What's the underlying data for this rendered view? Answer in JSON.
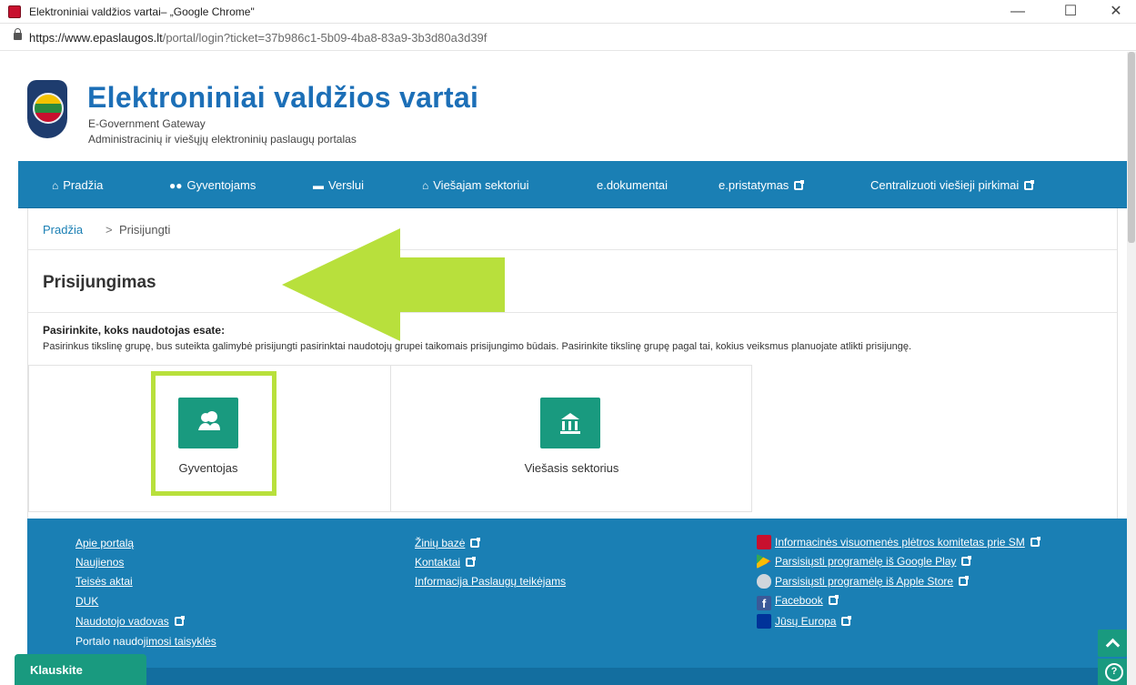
{
  "window": {
    "title": "Elektroniniai valdžios vartai– „Google Chrome\"",
    "minimize_glyph": "—",
    "maximize_glyph": "☐",
    "close_glyph": "✕"
  },
  "address": {
    "host": "https://www.epaslaugos.lt",
    "path": "/portal/login?ticket=37b986c1-5b09-4ba8-83a9-3b3d80a3d39f"
  },
  "header": {
    "title": "Elektroniniai valdžios vartai",
    "subtitle_en": "E-Government Gateway",
    "subtitle_lt": "Administracinių ir viešųjų elektroninių paslaugų portalas"
  },
  "nav": {
    "items": [
      {
        "label": "Pradžia",
        "icon": "home-icon"
      },
      {
        "label": "Gyventojams",
        "icon": "users-icon"
      },
      {
        "label": "Verslui",
        "icon": "briefcase-icon"
      },
      {
        "label": "Viešajam sektoriui",
        "icon": "institution-icon"
      },
      {
        "label": "e.dokumentai"
      },
      {
        "label": "e.pristatymas",
        "icon": "external-link-icon"
      },
      {
        "label": "Centralizuoti viešieji pirkimai",
        "icon": "external-link-icon"
      }
    ]
  },
  "breadcrumb": {
    "home": "Pradžia",
    "separator": ">",
    "current": "Prisijungti"
  },
  "page": {
    "title": "Prisijungimas",
    "choose_title": "Pasirinkite, koks naudotojas esate:",
    "choose_desc": "Pasirinkus tikslinę grupę, bus suteikta galimybė prisijungti pasirinktai naudotojų grupei taikomais prisijungimo būdais. Pasirinkite tikslinę grupę pagal tai, kokius veiksmus planuojate atlikti prisijungę."
  },
  "cards": [
    {
      "label": "Gyventojas",
      "icon": "users-icon"
    },
    {
      "label": "Viešasis sektorius",
      "icon": "institution-icon"
    }
  ],
  "footer": {
    "col1": [
      "Apie portalą",
      "Naujienos",
      "Teisės aktai",
      "DUK",
      "Naudotojo vadovas"
    ],
    "col1_rules_prefix": "Portalo naudo",
    "col1_rules_link": "jimosi taisyklės",
    "col2": [
      "Žinių bazė",
      "Kontaktai",
      "Informacija Paslaugų teikėjams"
    ],
    "col3": [
      {
        "label": "Informacinės visuomenės plėtros komitetas prie SM",
        "icon": "lithuania-emblem-icon"
      },
      {
        "label": "Parsisiųsti programėlę iš Google Play",
        "icon": "google-play-icon"
      },
      {
        "label": "Parsisiųsti programėlę iš Apple Store",
        "icon": "apple-icon"
      },
      {
        "label": "Facebook",
        "icon": "facebook-icon"
      },
      {
        "label": "Jūsų Europa",
        "icon": "eu-flag-icon"
      }
    ],
    "facebook_glyph": "f"
  },
  "chat": {
    "label": "Klauskite"
  },
  "colors": {
    "brand_blue": "#1a7fb4",
    "accent_teal": "#199a7f",
    "highlight_green": "#b8e03c",
    "title_blue": "#1c6fb7"
  }
}
